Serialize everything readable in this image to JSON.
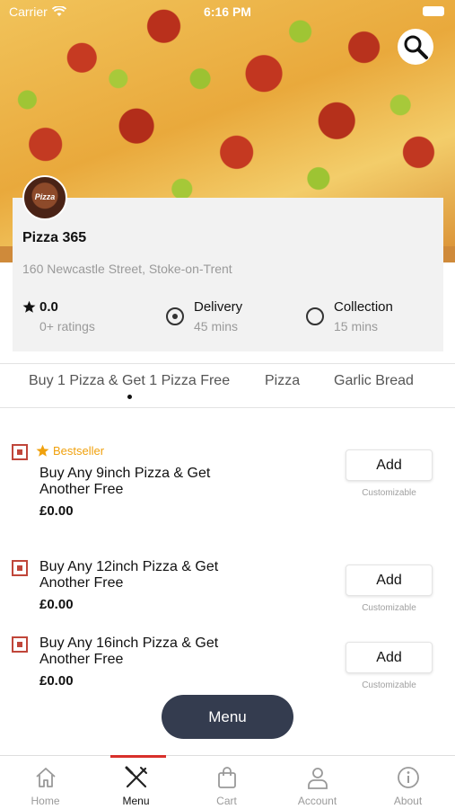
{
  "status_bar": {
    "carrier": "Carrier",
    "time": "6:16 PM"
  },
  "restaurant": {
    "name": "Pizza 365",
    "address": "160 Newcastle Street, Stoke-on-Trent",
    "rating": "0.0",
    "ratings_count": "0+ ratings",
    "logo_text": "Pizza",
    "delivery": {
      "label": "Delivery",
      "time": "45 mins",
      "selected": true
    },
    "collection": {
      "label": "Collection",
      "time": "15 mins",
      "selected": false
    }
  },
  "category_tabs": [
    {
      "label": "Buy 1 Pizza & Get 1 Pizza Free",
      "active": true
    },
    {
      "label": "Pizza",
      "active": false
    },
    {
      "label": "Garlic Bread",
      "active": false
    }
  ],
  "items": [
    {
      "badge": "Bestseller",
      "name": "Buy Any 9inch Pizza & Get Another Free",
      "price": "£0.00",
      "button": "Add",
      "note": "Customizable"
    },
    {
      "badge": "",
      "name": "Buy Any 12inch Pizza & Get Another Free",
      "price": "£0.00",
      "button": "Add",
      "note": "Customizable"
    },
    {
      "badge": "",
      "name": "Buy Any 16inch Pizza & Get Another Free",
      "price": "£0.00",
      "button": "Add",
      "note": "Customizable"
    }
  ],
  "menu_button": "Menu",
  "bottom_nav": [
    {
      "label": "Home",
      "icon": "home-icon"
    },
    {
      "label": "Menu",
      "icon": "fork-knife-icon",
      "active": true
    },
    {
      "label": "Cart",
      "icon": "shopping-bag-icon"
    },
    {
      "label": "Account",
      "icon": "user-icon"
    },
    {
      "label": "About",
      "icon": "info-icon"
    }
  ],
  "colors": {
    "accent_red": "#d8302b",
    "bestseller": "#f0a10d",
    "menu_button": "#343c4f",
    "veg_marker": "#c0463a"
  }
}
